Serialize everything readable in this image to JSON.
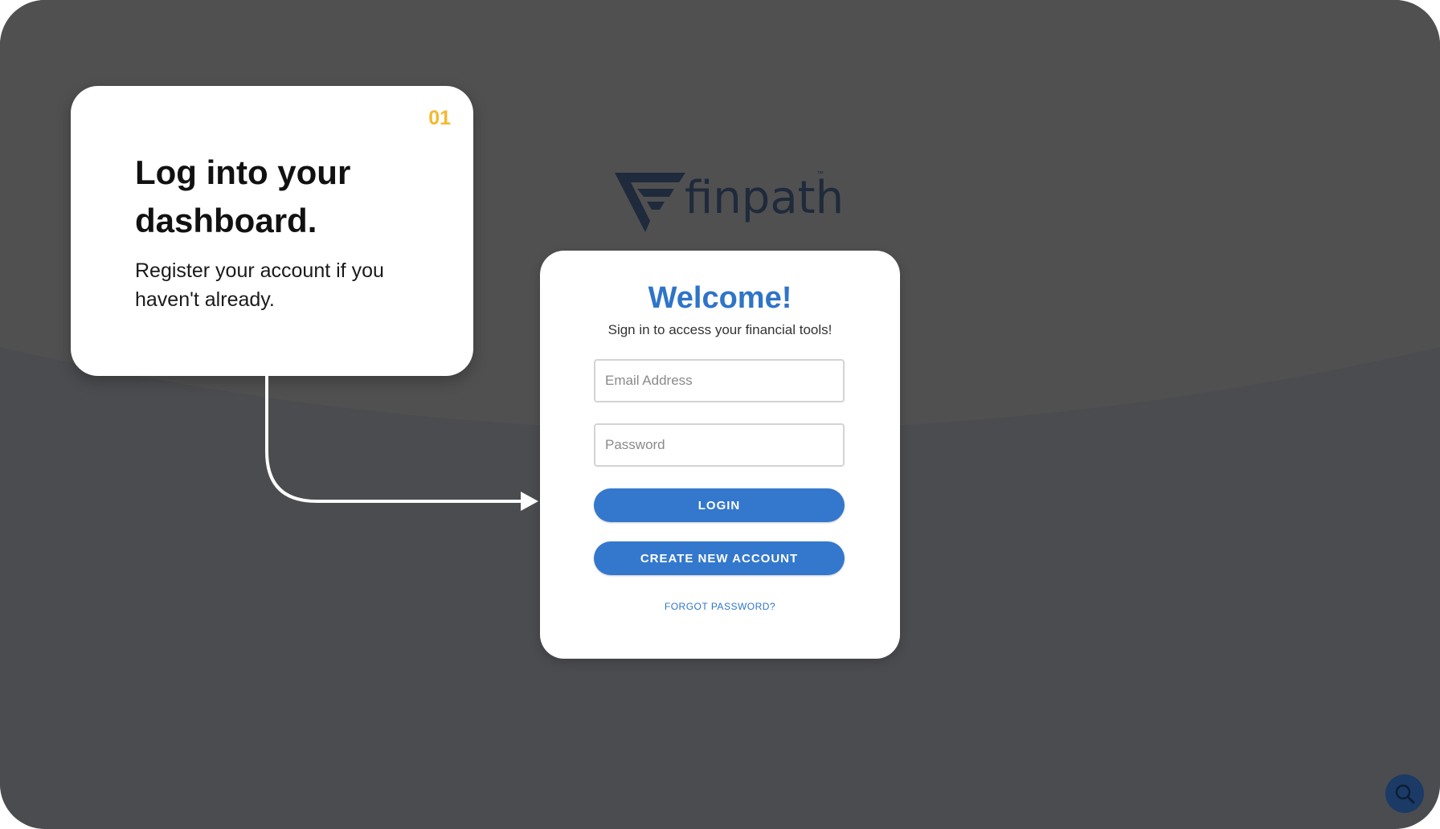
{
  "step": {
    "number": "01",
    "title": "Log into your dashboard.",
    "description": "Register your account if you haven't already."
  },
  "logo": {
    "name": "finpath",
    "trademark": "™"
  },
  "login": {
    "welcome": "Welcome!",
    "subtitle": "Sign in to access your financial tools!",
    "email_placeholder": "Email Address",
    "email_value": "",
    "password_placeholder": "Password",
    "password_value": "",
    "login_label": "LOGIN",
    "create_label": "CREATE NEW ACCOUNT",
    "forgot_label": "FORGOT PASSWORD?"
  },
  "icons": {
    "logo_mark": "finpath-logo-icon",
    "fab": "search-icon",
    "connector": "arrow-right-icon"
  },
  "colors": {
    "background": "#4a4c4f",
    "accent_blue": "#3478cd",
    "step_number": "#f5b82e",
    "logo_navy": "#1f2a3c",
    "fab": "#1b3a66"
  }
}
